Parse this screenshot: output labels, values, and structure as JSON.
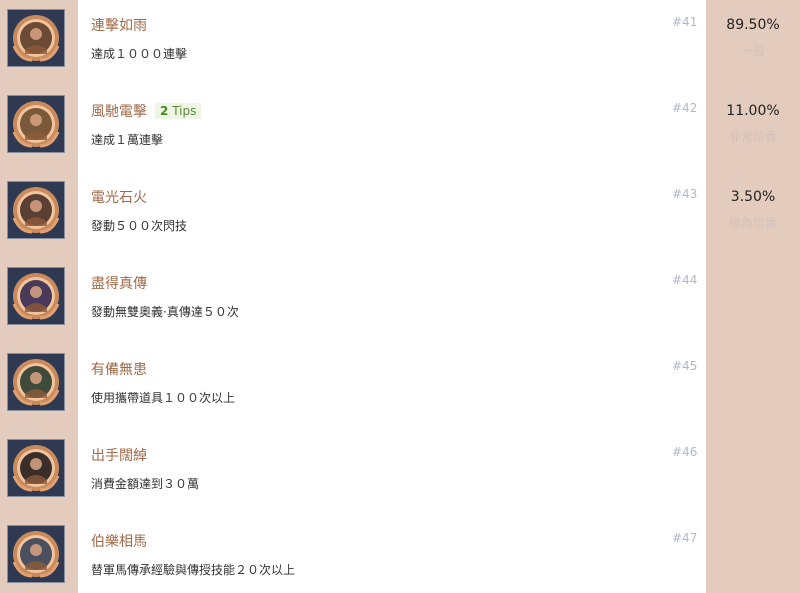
{
  "achievements": [
    {
      "title": "連擊如雨",
      "tips": null,
      "desc": "達成１０００連擊",
      "num": "#41",
      "rate": "89.50%",
      "rarity": "一般",
      "face": "#6b4a36"
    },
    {
      "title": "風馳電擊",
      "tips": {
        "count": "2",
        "label": "Tips"
      },
      "desc": "達成１萬連擊",
      "num": "#42",
      "rate": "11.00%",
      "rarity": "非常珍貴",
      "face": "#7a5a3a"
    },
    {
      "title": "電光石火",
      "tips": null,
      "desc": "發動５００次閃技",
      "num": "#43",
      "rate": "3.50%",
      "rarity": "極為珍貴",
      "face": "#5a4034"
    },
    {
      "title": "盡得真傳",
      "tips": null,
      "desc": "發動無雙奧義·真傳達５０次",
      "num": "#44",
      "rate": null,
      "rarity": null,
      "face": "#4a3a5a"
    },
    {
      "title": "有備無患",
      "tips": null,
      "desc": "使用攜帶道具１００次以上",
      "num": "#45",
      "rate": null,
      "rarity": null,
      "face": "#3e4a3a"
    },
    {
      "title": "出手闊綽",
      "tips": null,
      "desc": "消費金額達到３０萬",
      "num": "#46",
      "rate": null,
      "rarity": null,
      "face": "#3a2e2a"
    },
    {
      "title": "伯樂相馬",
      "tips": null,
      "desc": "替軍馬傳承經驗與傳授技能２０次以上",
      "num": "#47",
      "rate": null,
      "rarity": null,
      "face": "#4a5060"
    }
  ],
  "colors": {
    "side_panel": "#e3cbbd",
    "title": "#a06a4a",
    "number": "#b0b8c8",
    "rarity": "#d2c2bb"
  }
}
